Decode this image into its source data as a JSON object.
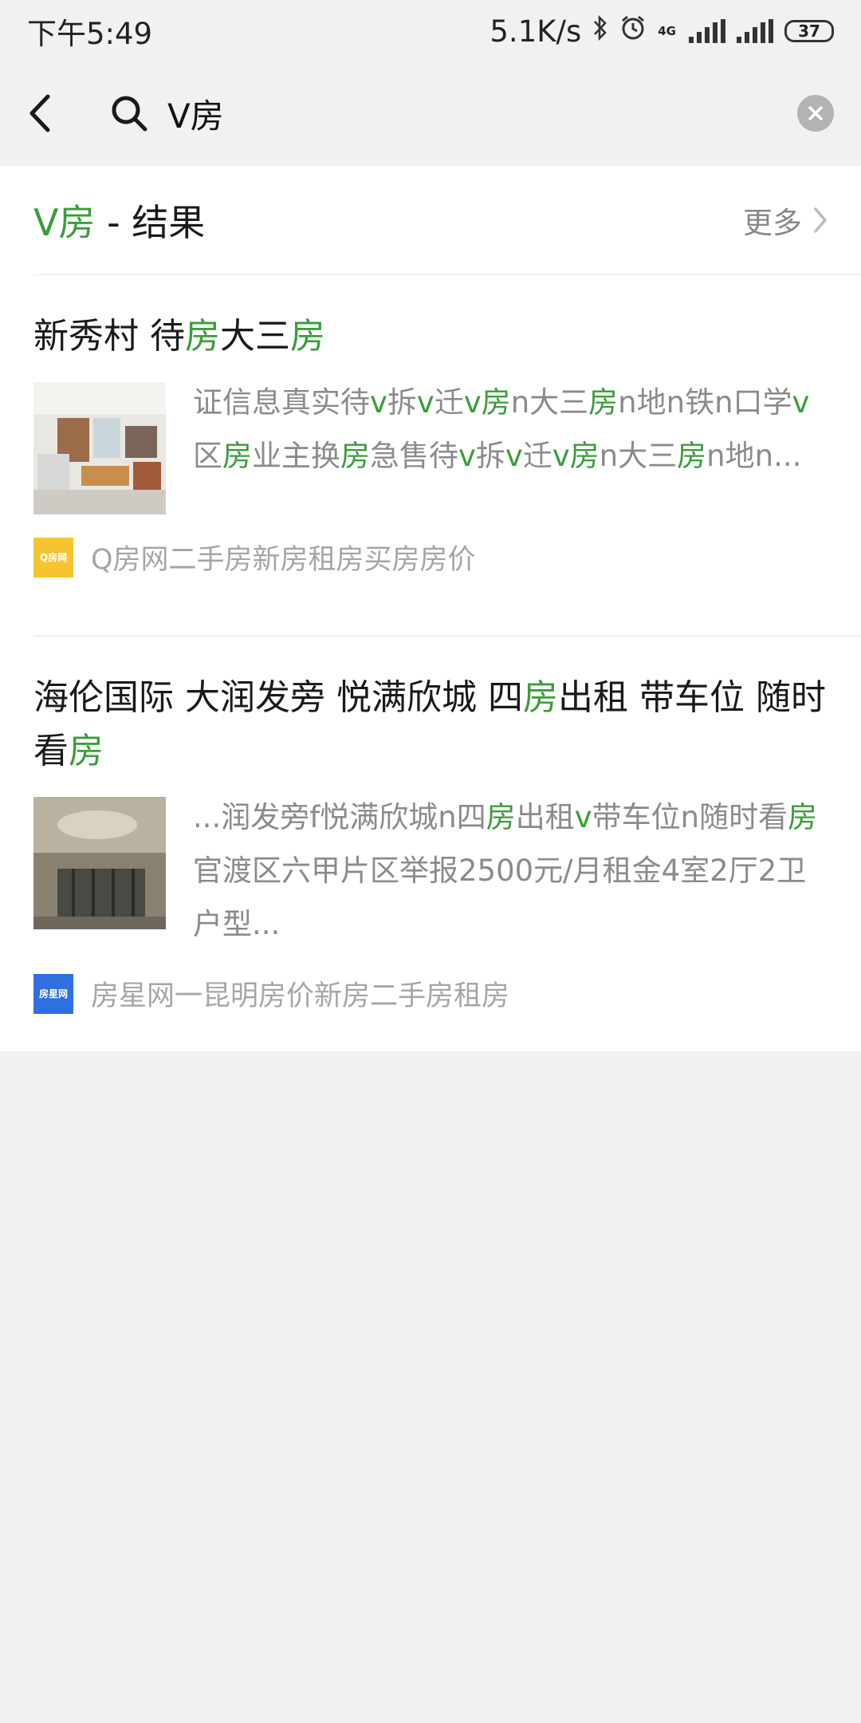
{
  "status_bar": {
    "time": "下午5:49",
    "net_speed": "5.1K/s",
    "network": "4G",
    "battery": "37"
  },
  "search": {
    "query": "V房"
  },
  "section": {
    "title_highlight": "V房",
    "title_rest": " - 结果",
    "more_label": "更多"
  },
  "results": [
    {
      "title": [
        {
          "t": "新秀村 待",
          "hl": false
        },
        {
          "t": "房",
          "hl": true
        },
        {
          "t": "大三",
          "hl": false
        },
        {
          "t": "房",
          "hl": true
        }
      ],
      "snippet": [
        {
          "t": "证信息真实待",
          "hl": false
        },
        {
          "t": "v",
          "hl": true
        },
        {
          "t": "拆",
          "hl": false
        },
        {
          "t": "v",
          "hl": true
        },
        {
          "t": "迁",
          "hl": false
        },
        {
          "t": "v房",
          "hl": true
        },
        {
          "t": "n大三",
          "hl": false
        },
        {
          "t": "房",
          "hl": true
        },
        {
          "t": "n地n铁n口学",
          "hl": false
        },
        {
          "t": "v",
          "hl": true
        },
        {
          "t": "区",
          "hl": false
        },
        {
          "t": "房",
          "hl": true
        },
        {
          "t": "业主换",
          "hl": false
        },
        {
          "t": "房",
          "hl": true
        },
        {
          "t": "急售待",
          "hl": false
        },
        {
          "t": "v",
          "hl": true
        },
        {
          "t": "拆",
          "hl": false
        },
        {
          "t": "v",
          "hl": true
        },
        {
          "t": "迁",
          "hl": false
        },
        {
          "t": "v房",
          "hl": true
        },
        {
          "t": "n大三",
          "hl": false
        },
        {
          "t": "房",
          "hl": true
        },
        {
          "t": "n地n...",
          "hl": false
        }
      ],
      "source": "Q房网二手房新房租房买房房价",
      "source_logo_text": "Q房网",
      "source_logo_color": "#f6c431"
    },
    {
      "title": [
        {
          "t": "海伦国际 大润发旁 悦满欣城 四",
          "hl": false
        },
        {
          "t": "房",
          "hl": true
        },
        {
          "t": "出租 带车位 随时看",
          "hl": false
        },
        {
          "t": "房",
          "hl": true
        }
      ],
      "snippet": [
        {
          "t": "...润发旁f悦满欣城n四",
          "hl": false
        },
        {
          "t": "房",
          "hl": true
        },
        {
          "t": "出租",
          "hl": false
        },
        {
          "t": "v",
          "hl": true
        },
        {
          "t": "带车位n随时看",
          "hl": false
        },
        {
          "t": "房",
          "hl": true
        },
        {
          "t": "官渡区六甲片区举报2500元/月租金4室2厅2卫户型...",
          "hl": false
        }
      ],
      "source": "房星网一昆明房价新房二手房租房",
      "source_logo_text": "房星网",
      "source_logo_color": "#2f6fe0"
    }
  ],
  "colors": {
    "highlight": "#3a9e3a",
    "page_bg": "#f1f1f1"
  }
}
